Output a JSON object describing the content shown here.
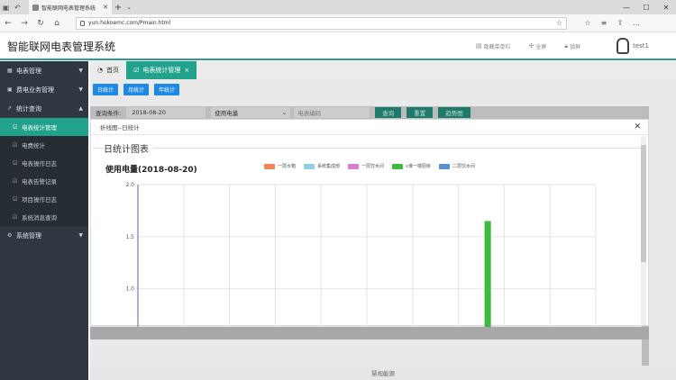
{
  "browser": {
    "tab_title": "智能联网电表管理系统",
    "url": "yun.hokoemc.com/Pmain.html"
  },
  "header": {
    "title": "智能联网电表管理系统",
    "hide_menu": "隐藏菜单栏",
    "fullscreen": "全屏",
    "lock": "锁屏",
    "user": "test1"
  },
  "sidebar": {
    "items": [
      {
        "label": "电表管理",
        "icon": "meter-icon"
      },
      {
        "label": "费电业务管理",
        "icon": "dollar-icon"
      },
      {
        "label": "统计查询",
        "icon": "chart-icon"
      }
    ],
    "subitems": [
      {
        "label": "电表统计管理",
        "active": true
      },
      {
        "label": "电费统计",
        "active": false
      },
      {
        "label": "电表操作日志",
        "active": false
      },
      {
        "label": "电表告警记录",
        "active": false
      },
      {
        "label": "项目操作日志",
        "active": false
      },
      {
        "label": "系统消息查询",
        "active": false
      }
    ],
    "system": {
      "label": "系统管理",
      "icon": "gear-icon"
    }
  },
  "tabs": [
    {
      "label": "首页"
    },
    {
      "label": "电表统计管理"
    }
  ],
  "toolbar": {
    "day": "日统计",
    "month": "月统计",
    "year": "年统计"
  },
  "filter": {
    "label": "查询条件:",
    "date": "2018-08-20",
    "type": "使用电量",
    "meter_placeholder": "电表编码",
    "query": "查询",
    "reset": "重置",
    "export": "趋势图"
  },
  "modal": {
    "header": "折线图--日统计",
    "section_title": "日统计图表"
  },
  "chart_data": {
    "type": "bar",
    "title": "使用电量(2018-08-20)",
    "series": [
      {
        "name": "一层水箱",
        "color": "#f0845c",
        "values": [
          null,
          null,
          null,
          null,
          null,
          null,
          null,
          null,
          null,
          null
        ]
      },
      {
        "name": "系统集成部",
        "color": "#8fcfe6",
        "values": [
          null,
          null,
          null,
          null,
          null,
          null,
          null,
          null,
          null,
          null
        ]
      },
      {
        "name": "一层饮水间",
        "color": "#d97fd0",
        "values": [
          null,
          null,
          null,
          null,
          null,
          null,
          null,
          null,
          null,
          null
        ]
      },
      {
        "name": "v谁一楼厨房",
        "color": "#3dbb3d",
        "values": [
          null,
          null,
          null,
          null,
          null,
          null,
          null,
          1.65,
          null,
          null
        ]
      },
      {
        "name": "二层饮水间",
        "color": "#5b8fd6",
        "values": [
          null,
          null,
          null,
          null,
          null,
          null,
          null,
          null,
          null,
          null
        ]
      }
    ],
    "ylim": [
      0.6,
      2.0
    ],
    "yticks": [
      2.0,
      1.5,
      1.0
    ]
  },
  "status": {
    "text": "慧视能源"
  }
}
